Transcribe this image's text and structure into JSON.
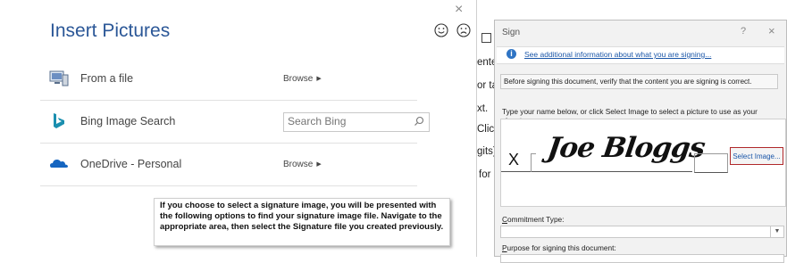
{
  "insert_pictures": {
    "title": "Insert Pictures",
    "close": "×",
    "rows": [
      {
        "label": "From a file",
        "action": "Browse",
        "icon": "computer-icon"
      },
      {
        "label": "Bing Image Search",
        "search_placeholder": "Search Bing",
        "icon": "bing-icon"
      },
      {
        "label": "OneDrive - Personal",
        "action": "Browse",
        "icon": "onedrive-icon"
      }
    ],
    "callout": "If you choose to select a signature image, you will be presented with the following options to find your signature image file. Navigate to the appropriate area, then select the Signature file you created previously."
  },
  "background_doc": {
    "fragments": [
      "ente",
      "or ta",
      "xt.",
      "Click",
      "gits)",
      "for"
    ]
  },
  "sign_dialog": {
    "title": "Sign",
    "help": "?",
    "close": "×",
    "info_link": "See additional information about what you are signing...",
    "verify_text": "Before signing this document, verify that the content you are signing is correct.",
    "type_label": "Type your name below, or click Select Image to select a picture to use as your signature:",
    "signature_mark": "X",
    "signature_text": "Joe Bloggs",
    "select_image_button": "Select Image...",
    "commitment_label_first": "C",
    "commitment_label_rest": "ommitment Type:",
    "purpose_label_first": "P",
    "purpose_label_rest": "urpose for signing this document:"
  }
}
